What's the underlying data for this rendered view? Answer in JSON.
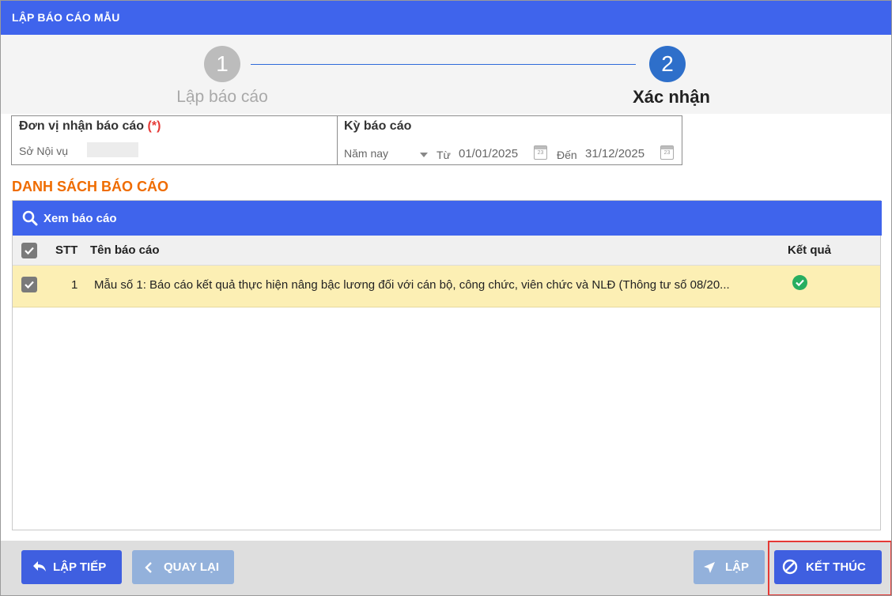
{
  "window": {
    "title": "LẬP BÁO CÁO MẪU"
  },
  "stepper": {
    "steps": [
      {
        "number": "1",
        "label": "Lập báo cáo"
      },
      {
        "number": "2",
        "label": "Xác nhận"
      }
    ]
  },
  "form": {
    "unit_label": "Đơn vị nhận báo cáo",
    "required_mark": "(*)",
    "unit_value": "Sở Nội vụ",
    "period_label": "Kỳ báo cáo",
    "period_select": "Năm nay",
    "from_label": "Từ",
    "from_date": "01/01/2025",
    "to_label": "Đến",
    "to_date": "31/12/2025",
    "calendar_icon_number": "23"
  },
  "report_list": {
    "title": "DANH SÁCH BÁO CÁO",
    "toolbar": {
      "view_label": "Xem báo cáo",
      "icon": "search-icon"
    },
    "columns": {
      "stt": "STT",
      "name": "Tên báo cáo",
      "result": "Kết quả"
    },
    "rows": [
      {
        "checked": true,
        "stt": "1",
        "name": "Mẫu số 1: Báo cáo kết quả thực hiện nâng bậc lương đối với cán bộ, công chức, viên chức và NLĐ (Thông tư số 08/20...",
        "result_icon": "check-circle-icon"
      }
    ]
  },
  "footer": {
    "continue_label": "LẬP TIẾP",
    "back_label": "QUAY LẠI",
    "make_label": "LẬP",
    "finish_label": "KẾT THÚC"
  },
  "colors": {
    "primary": "#3f64ec",
    "step_active": "#2e6fca",
    "step_inactive": "#bcbcbc",
    "section_title": "#ef6c00",
    "row_selected": "#fcefb4",
    "success": "#27ae60",
    "disabled_button": "#93b1db",
    "highlight": "#e53935"
  }
}
